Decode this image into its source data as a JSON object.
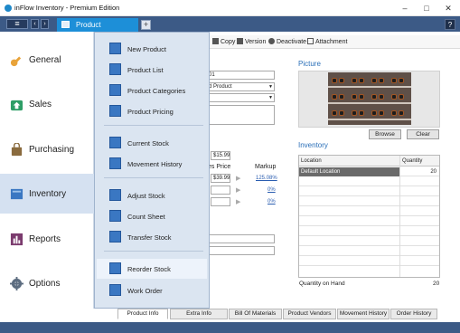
{
  "window": {
    "title": "inFlow Inventory - Premium Edition",
    "minimize": "–",
    "maximize": "□",
    "close": "✕"
  },
  "tabbar": {
    "menu_icon": "≡",
    "back": "‹",
    "forward": "›",
    "doc_tab": "Product",
    "new_tab": "+",
    "help": "?"
  },
  "toolbar": {
    "copy": "Copy",
    "version": "Version",
    "deactivate": "Deactivate",
    "attachment": "Attachment"
  },
  "form": {
    "name_fragment": "01",
    "type_select": "d Product",
    "price_partial_label": "es Price",
    "markup_label": "Markup",
    "cost_value": "$15.99",
    "price_value": "$39.99",
    "markup_1": "125.08%",
    "markup_2": "0%",
    "markup_3": "0%"
  },
  "picture": {
    "title": "Picture",
    "browse": "Browse",
    "clear": "Clear"
  },
  "inventory": {
    "title": "Inventory",
    "columns": [
      "Location",
      "Quantity"
    ],
    "rows": [
      {
        "location": "Default Location",
        "quantity": "20"
      }
    ],
    "total_label": "Quantity on Hand",
    "total_value": "20"
  },
  "bottom_tabs": [
    "Product Info",
    "Extra Info",
    "Bill Of Materials",
    "Product Vendors",
    "Movement History",
    "Order History"
  ],
  "menu": {
    "categories": [
      {
        "label": "General",
        "icon": "key-icon",
        "color": "#e8a33a"
      },
      {
        "label": "Sales",
        "icon": "sales-icon",
        "color": "#2f9e67"
      },
      {
        "label": "Purchasing",
        "icon": "shopping-bag-icon",
        "color": "#8a6b3e"
      },
      {
        "label": "Inventory",
        "icon": "inventory-box-icon",
        "color": "#3a77c2"
      },
      {
        "label": "Reports",
        "icon": "chart-icon",
        "color": "#7b3b6e"
      },
      {
        "label": "Options",
        "icon": "gear-icon",
        "color": "#5d6d80"
      }
    ],
    "items": [
      {
        "label": "New Product",
        "icon": "new-product-icon"
      },
      {
        "label": "Product List",
        "icon": "product-list-icon"
      },
      {
        "label": "Product Categories",
        "icon": "product-categories-icon"
      },
      {
        "label": "Product Pricing",
        "icon": "product-pricing-icon"
      },
      {
        "label": "Current Stock",
        "icon": "current-stock-icon"
      },
      {
        "label": "Movement History",
        "icon": "movement-history-icon"
      },
      {
        "label": "Adjust Stock",
        "icon": "adjust-stock-icon"
      },
      {
        "label": "Count Sheet",
        "icon": "count-sheet-icon"
      },
      {
        "label": "Transfer Stock",
        "icon": "transfer-stock-icon"
      },
      {
        "label": "Reorder Stock",
        "icon": "reorder-stock-icon"
      },
      {
        "label": "Work Order",
        "icon": "work-order-icon"
      }
    ]
  }
}
